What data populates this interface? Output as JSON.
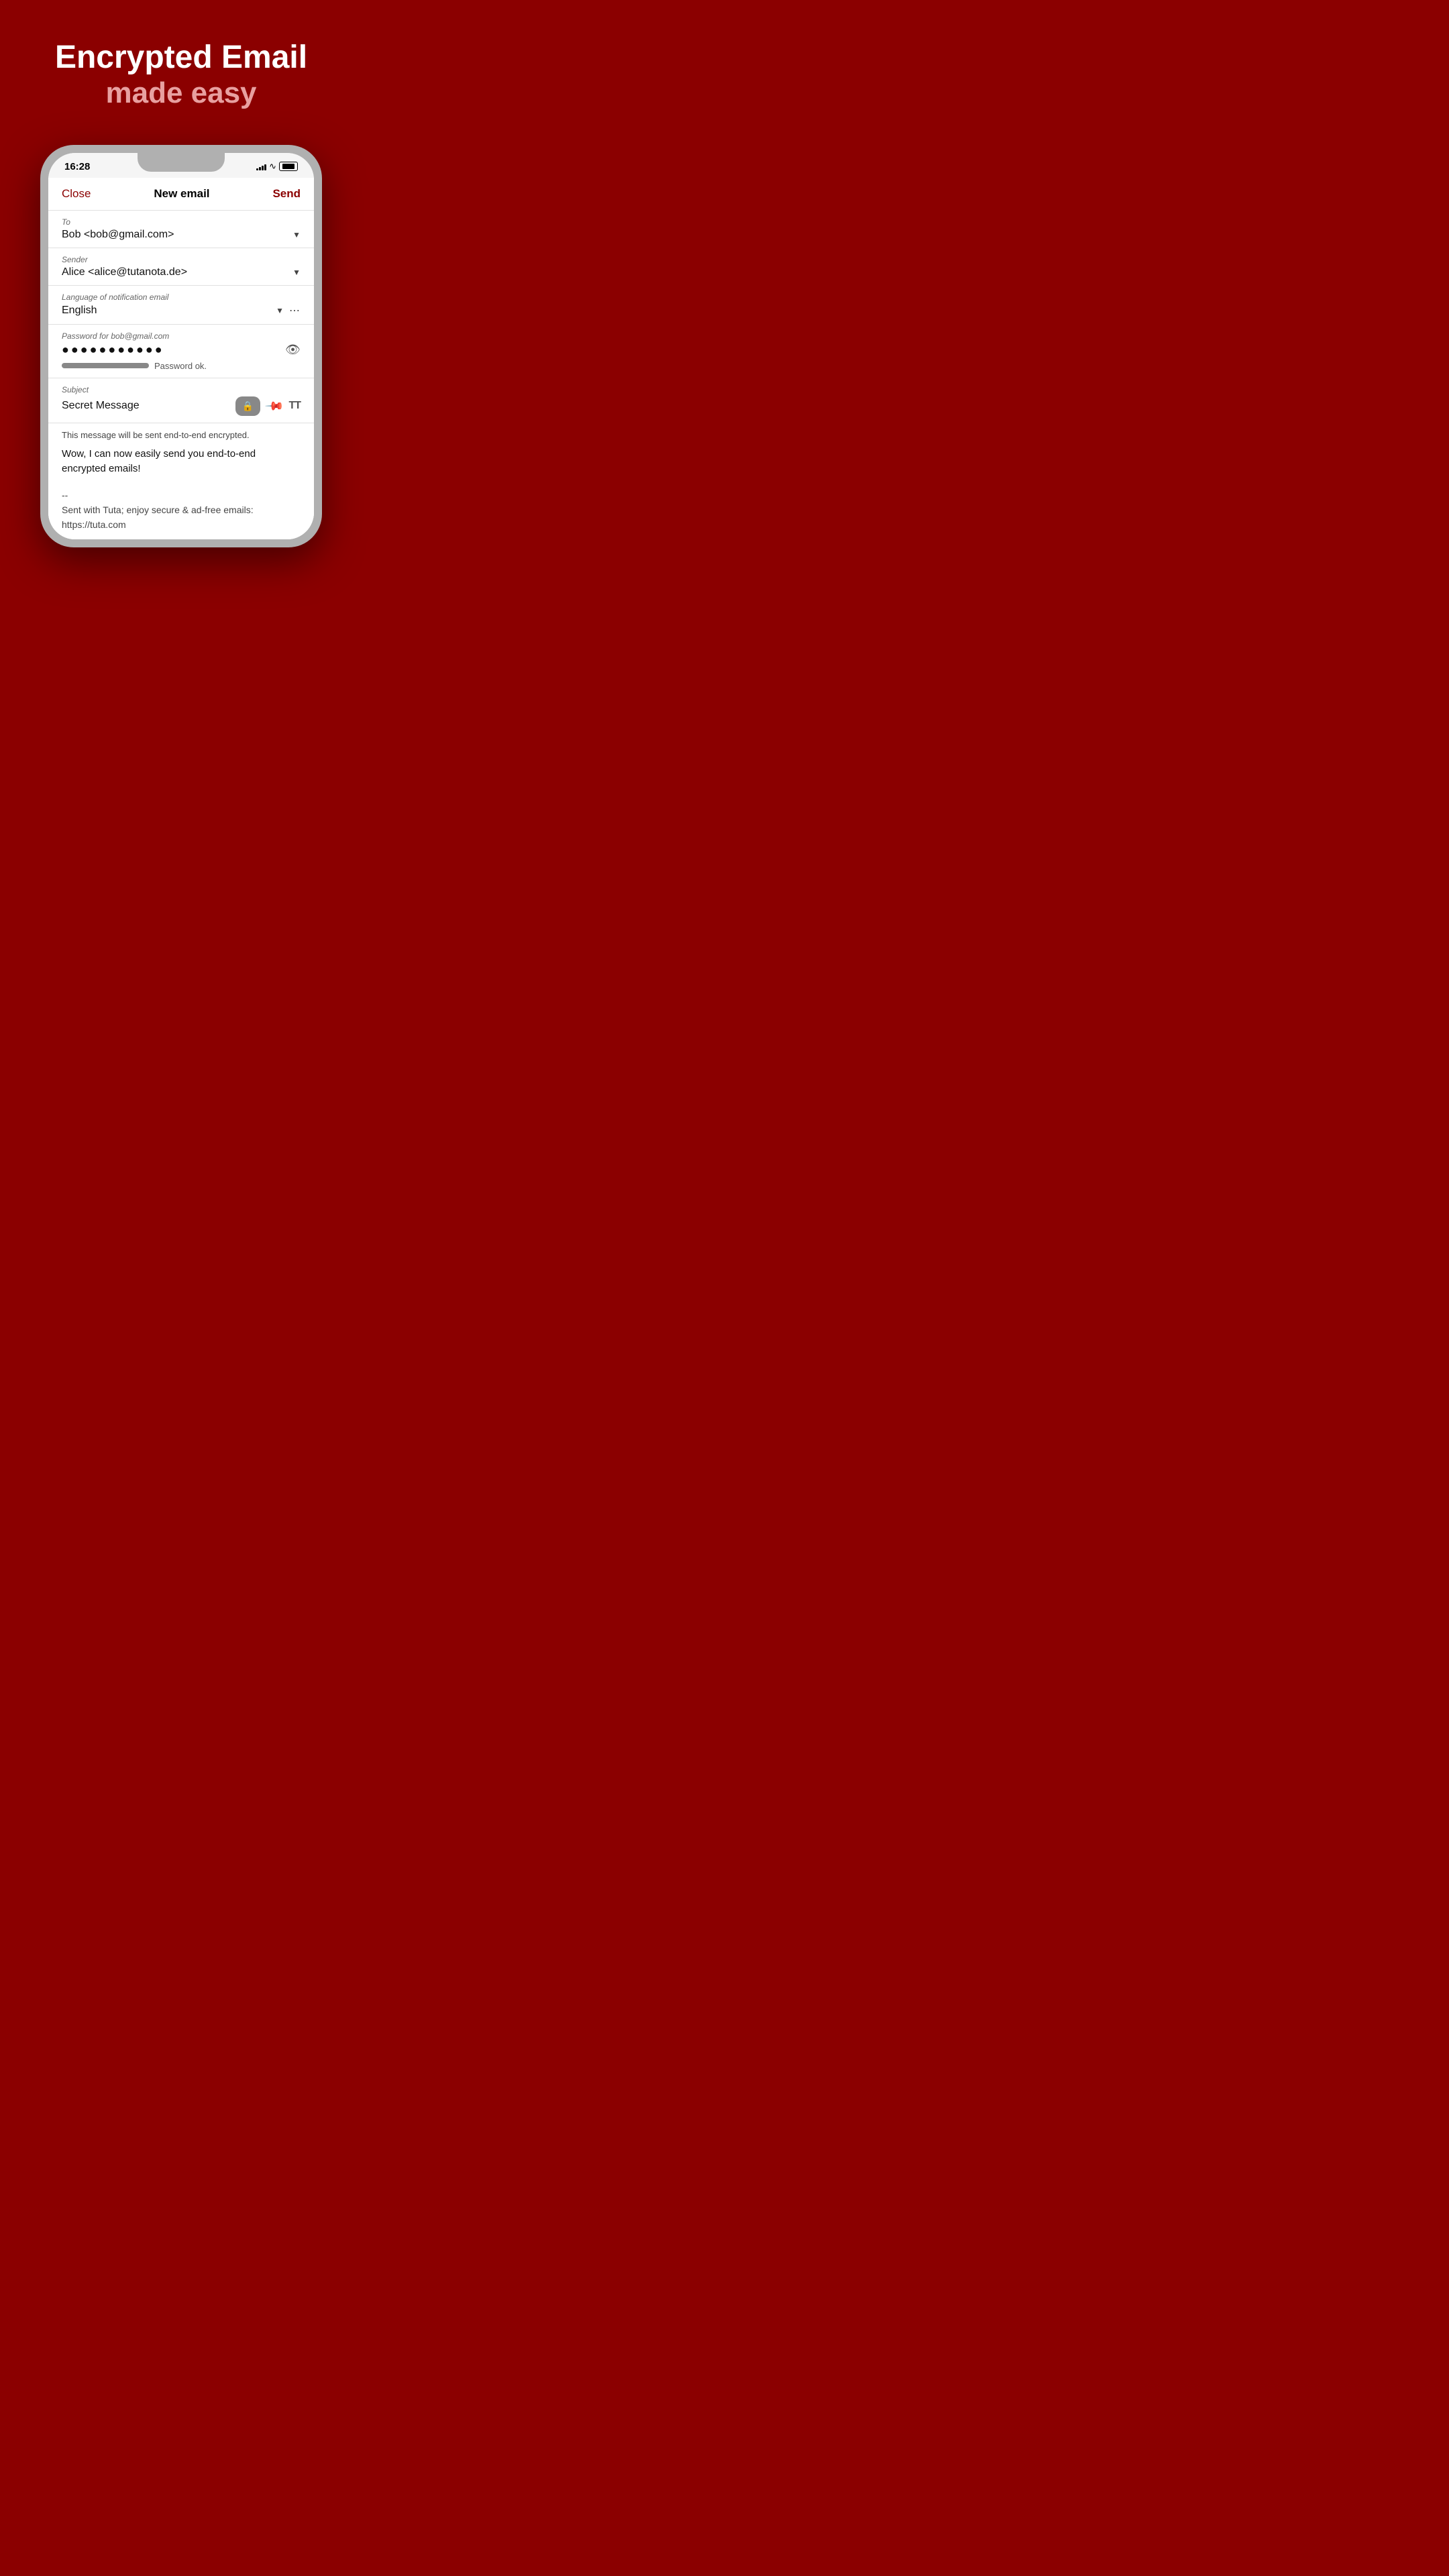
{
  "hero": {
    "title": "Encrypted Email",
    "subtitle": "made easy"
  },
  "status_bar": {
    "time": "16:28"
  },
  "compose": {
    "close_label": "Close",
    "title": "New email",
    "send_label": "Send",
    "to_label": "To",
    "to_value": "Bob <bob@gmail.com>",
    "sender_label": "Sender",
    "sender_value": "Alice <alice@tutanota.de>",
    "lang_label": "Language of notification email",
    "lang_value": "English",
    "password_label": "Password for bob@gmail.com",
    "password_value": "●●●●●●●●●●●",
    "password_strength": "Password ok.",
    "subject_label": "Subject",
    "subject_value": "Secret Message",
    "encrypted_notice": "This message will be sent end-to-end encrypted.",
    "body_text": "Wow, I can now easily send you end-to-end encrypted emails!",
    "signature_line1": "--",
    "signature_line2": "Sent with Tuta; enjoy secure & ad-free emails:",
    "signature_line3": "https://tuta.com"
  }
}
